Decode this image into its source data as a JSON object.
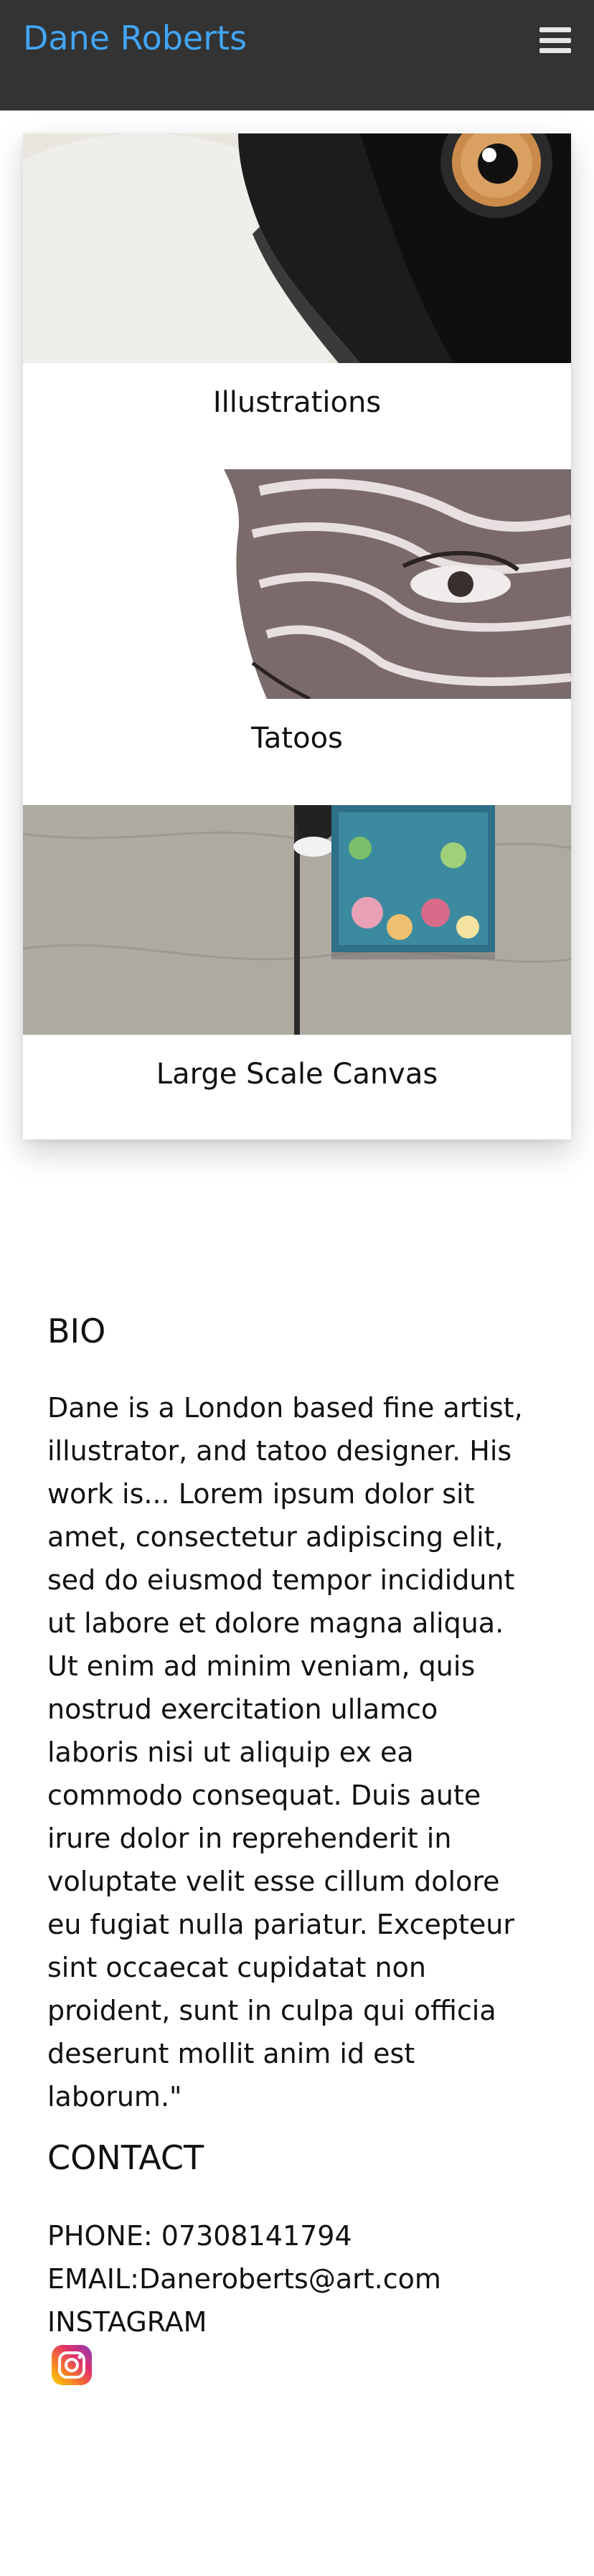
{
  "navbar": {
    "brand": "Dane Roberts",
    "menu_icon": "hamburger-menu-icon",
    "background": "#333333",
    "brand_color": "#42a5f5"
  },
  "portfolio": {
    "cards": [
      {
        "caption": "Illustrations",
        "image": "illustration-eye-artwork"
      },
      {
        "caption": "Tatoos",
        "image": "tattoo-face-sketch"
      },
      {
        "caption": "Large Scale Canvas",
        "image": "canvas-on-wall-with-lamp"
      }
    ]
  },
  "bio": {
    "heading": "BIO",
    "text": "Dane is a London based fine artist, illustrator, and tatoo designer. His work is... Lorem ipsum dolor sit amet, consectetur adipiscing elit, sed do eiusmod tempor incididunt ut labore et dolore magna aliqua. Ut enim ad minim veniam, quis nostrud exercitation ullamco laboris nisi ut aliquip ex ea commodo consequat. Duis aute irure dolor in reprehenderit in voluptate velit esse cillum dolore eu fugiat nulla pariatur. Excepteur sint occaecat cupidatat non proident, sunt in culpa qui officia deserunt mollit anim id est laborum.\""
  },
  "contact": {
    "heading": "CONTACT",
    "phone": "PHONE: 07308141794",
    "email": "EMAIL:Daneroberts@art.com",
    "instagram": "INSTAGRAM",
    "instagram_icon": "instagram-icon"
  }
}
